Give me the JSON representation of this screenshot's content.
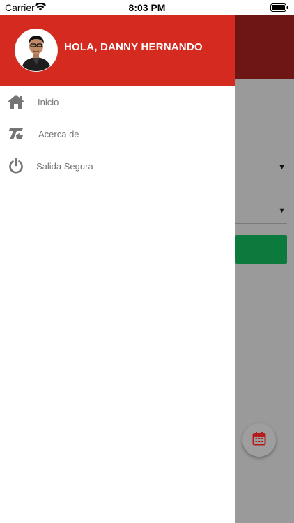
{
  "status_bar": {
    "carrier": "Carrier",
    "time": "8:03 PM"
  },
  "drawer": {
    "greeting": "HOLA, DANNY HERNANDO",
    "items": [
      {
        "label": "Inicio",
        "icon": "home-icon"
      },
      {
        "label": "Acerca de",
        "icon": "app-logo-icon"
      },
      {
        "label": "Salida Segura",
        "icon": "power-icon"
      }
    ]
  },
  "colors": {
    "header": "#d42a1f",
    "overlay_header": "#6e1616",
    "overlay": "#9a9a9a",
    "green": "#0b7a3c",
    "icon_gray": "#757575",
    "calendar_red": "#b71c1c"
  },
  "background_screen": {
    "fab_icon": "calendar-icon"
  }
}
